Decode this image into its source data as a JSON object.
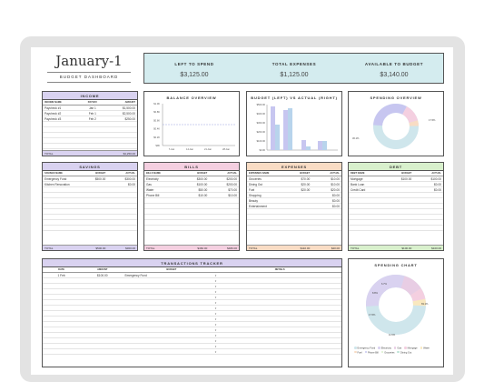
{
  "header": {
    "title": "January-1",
    "subtitle": "BUDGET DASHBOARD"
  },
  "summary": {
    "left_to_spend_label": "LEFT TO SPEND",
    "left_to_spend_value": "$3,125.00",
    "total_expenses_label": "TOTAL EXPENSES",
    "total_expenses_value": "$1,125.00",
    "available_label": "AVAILABLE TO BUDGET",
    "available_value": "$3,140.00"
  },
  "colors": {
    "income": "#d9d2f0",
    "savings": "#d9d2f0",
    "bills": "#f4cfe0",
    "expenses": "#f9dcc4",
    "debt": "#d8f0cc",
    "transactions": "#d9d2f0",
    "summary": "#d4ecef"
  },
  "income": {
    "title": "INCOME",
    "columns": [
      "INCOME NAME",
      "PAYDAY",
      "AMOUNT"
    ],
    "rows": [
      [
        "Paycheck #1",
        "Jan 1",
        "$1,500.00"
      ],
      [
        "Paycheck #2",
        "Feb 1",
        "$2,500.00"
      ],
      [
        "Paycheck #3",
        "Feb 2",
        "$250.00"
      ]
    ],
    "total_label": "TOTAL",
    "total_value": "$4,250.00"
  },
  "balance": {
    "title": "BALANCE OVERVIEW",
    "y_ticks": [
      "$1.0K",
      "$0.8K",
      "$0.6K",
      "$0.4K",
      "$0.2K",
      "$0K"
    ],
    "x_ticks": [
      "7-Jan",
      "14-Jan",
      "21-Jan",
      "28-Jan"
    ]
  },
  "budget_vs_actual": {
    "title": "BUDGET (LEFT) VS ACTUAL (RIGHT)",
    "y_ticks": [
      "$500.00",
      "$400.00",
      "$300.00",
      "$200.00",
      "$100.00",
      "$0.00"
    ]
  },
  "spending_overview": {
    "title": "SPENDING OVERVIEW",
    "label_left": "30.1%",
    "label_right": "17.5%",
    "label_bottom": "52.4%"
  },
  "savings": {
    "title": "SAVINGS",
    "columns": [
      "SAVINGS NAME",
      "BUDGET",
      "ACTUAL"
    ],
    "rows": [
      [
        "Emergency Fund",
        "$500.00",
        "$300.00"
      ],
      [
        "Kitchen Renovation",
        "",
        "$0.00"
      ]
    ],
    "total_label": "TOTAL",
    "total_budget": "$500.00",
    "total_actual": "$300.00"
  },
  "bills": {
    "title": "BILLS",
    "columns": [
      "BILLS NAME",
      "BUDGET",
      "ACTUAL"
    ],
    "rows": [
      [
        "Electricity",
        "$300.00",
        "$200.00"
      ],
      [
        "Gas",
        "$100.00",
        "$200.00"
      ],
      [
        "Water",
        "$50.00",
        "$70.00"
      ],
      [
        "Phone Bill",
        "$10.00",
        "$10.00"
      ]
    ],
    "total_label": "TOTAL",
    "total_budget": "$460.00",
    "total_actual": "$480.00"
  },
  "expenses": {
    "title": "EXPENSES",
    "columns": [
      "EXPENSES NAME",
      "BUDGET",
      "ACTUAL"
    ],
    "rows": [
      [
        "Groceries",
        "$70.00",
        "$10.00"
      ],
      [
        "Dining Out",
        "$20.00",
        "$10.00"
      ],
      [
        "Fuel",
        "$20.00",
        "$20.00"
      ],
      [
        "Shopping",
        "",
        "$0.00"
      ],
      [
        "Beauty",
        "",
        "$0.00"
      ],
      [
        "Entertainment",
        "",
        "$0.00"
      ]
    ],
    "total_label": "TOTAL",
    "total_budget": "$110.00",
    "total_actual": "$40.00"
  },
  "debt": {
    "title": "DEBT",
    "columns": [
      "DEBT NAME",
      "BUDGET",
      "ACTUAL"
    ],
    "rows": [
      [
        "Mortgage",
        "$100.00",
        "$100.00"
      ],
      [
        "Bank Loan",
        "",
        "$0.00"
      ],
      [
        "Credit Card",
        "",
        "$0.00"
      ]
    ],
    "total_label": "TOTAL",
    "total_budget": "$100.00",
    "total_actual": "$100.00"
  },
  "transactions": {
    "title": "TRANSACTIONS TRACKER",
    "columns": [
      "DATE",
      "AMOUNT",
      "BUDGET",
      "DETAILS"
    ],
    "rows": [
      [
        "1 Feb",
        "$100.00",
        "Emergency Fund",
        ""
      ]
    ]
  },
  "spending_chart": {
    "title": "SPENDING CHART",
    "labels": [
      "69.1%",
      "17.5%",
      "11.5%",
      "8.8%",
      "6.7%"
    ],
    "legend": [
      "Emergency Fund",
      "Electricity",
      "Gas",
      "Mortgage",
      "Water",
      "Fuel",
      "Phone Bill",
      "Groceries",
      "Dining Out"
    ]
  }
}
